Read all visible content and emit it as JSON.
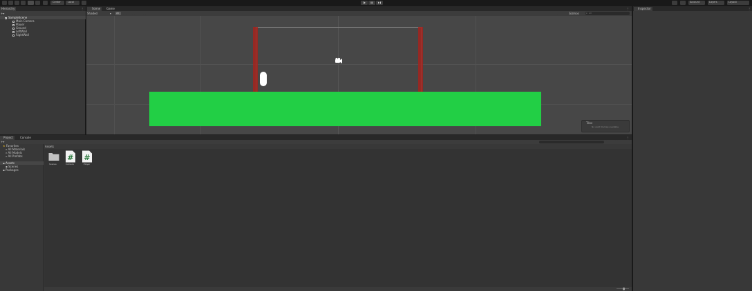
{
  "toolbar": {
    "account_label": "Account",
    "layers_label": "Layers",
    "layout_label": "Layout",
    "center_label": "Center",
    "local_label": "Local"
  },
  "hierarchy": {
    "tab_label": "Hierarchy",
    "scene_name": "SampleScene",
    "items": [
      "Main Camera",
      "Player",
      "Ground",
      "LeftWall",
      "RightWall"
    ]
  },
  "scene": {
    "scene_tab": "Scene",
    "game_tab": "Game",
    "shading_mode": "Shaded",
    "view_mode": "2D",
    "gizmos_label": "Gizmos",
    "search_placeholder": "All",
    "tiles_overlay_title": "Tiles",
    "tiles_overlay_text": "No valid tilemap available"
  },
  "inspector": {
    "tab_label": "Inspector"
  },
  "project": {
    "project_tab": "Project",
    "console_tab": "Console",
    "breadcrumb": "Assets",
    "tree": [
      {
        "label": "Favorites",
        "depth": 0
      },
      {
        "label": "All Materials",
        "depth": 1
      },
      {
        "label": "All Models",
        "depth": 1
      },
      {
        "label": "All Prefabs",
        "depth": 1
      },
      {
        "label": "Assets",
        "depth": 0
      },
      {
        "label": "Scenes",
        "depth": 1
      },
      {
        "label": "Packages",
        "depth": 0
      }
    ],
    "assets": [
      {
        "label": "Scenes",
        "type": "folder"
      },
      {
        "label": "Camera",
        "type": "script"
      },
      {
        "label": "Player",
        "type": "script"
      }
    ]
  },
  "colors": {
    "ground": "#22cf45",
    "walls": "#a3251e",
    "panel": "#383838",
    "scene_bg": "#474747"
  }
}
